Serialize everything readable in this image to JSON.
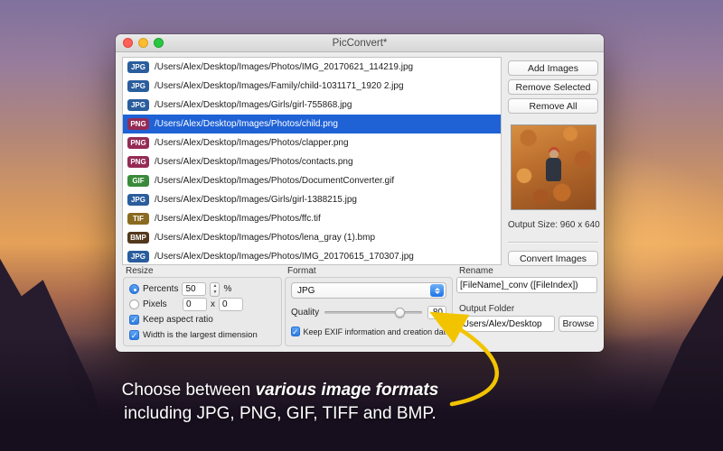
{
  "window": {
    "title": "PicConvert*",
    "buttons": {
      "add": "Add Images",
      "remove_selected": "Remove Selected",
      "remove_all": "Remove All",
      "convert": "Convert Images",
      "browse": "Browse"
    },
    "output_size": "Output Size: 960 x 640"
  },
  "file_list": {
    "items": [
      {
        "badge": "JPG",
        "path": "/Users/Alex/Desktop/Images/Photos/IMG_20170621_114219.jpg",
        "selected": false
      },
      {
        "badge": "JPG",
        "path": "/Users/Alex/Desktop/Images/Family/child-1031171_1920 2.jpg",
        "selected": false
      },
      {
        "badge": "JPG",
        "path": "/Users/Alex/Desktop/Images/Girls/girl-755868.jpg",
        "selected": false
      },
      {
        "badge": "PNG",
        "path": "/Users/Alex/Desktop/Images/Photos/child.png",
        "selected": true
      },
      {
        "badge": "PNG",
        "path": "/Users/Alex/Desktop/Images/Photos/clapper.png",
        "selected": false
      },
      {
        "badge": "PNG",
        "path": "/Users/Alex/Desktop/Images/Photos/contacts.png",
        "selected": false
      },
      {
        "badge": "GIF",
        "path": "/Users/Alex/Desktop/Images/Photos/DocumentConverter.gif",
        "selected": false
      },
      {
        "badge": "JPG",
        "path": "/Users/Alex/Desktop/Images/Girls/girl-1388215.jpg",
        "selected": false
      },
      {
        "badge": "TIF",
        "path": "/Users/Alex/Desktop/Images/Photos/ffc.tif",
        "selected": false
      },
      {
        "badge": "BMP",
        "path": "/Users/Alex/Desktop/Images/Photos/lena_gray (1).bmp",
        "selected": false
      },
      {
        "badge": "JPG",
        "path": "/Users/Alex/Desktop/Images/Photos/IMG_20170615_170307.jpg",
        "selected": false
      }
    ]
  },
  "resize": {
    "group_label": "Resize",
    "percents_label": "Percents",
    "percents_value": "50",
    "percent_sign": "%",
    "pixels_label": "Pixels",
    "pixels_width": "0",
    "pixels_separator": "x",
    "pixels_height": "0",
    "keep_aspect_label": "Keep aspect ratio",
    "width_largest_label": "Width is the largest dimension"
  },
  "format": {
    "group_label": "Format",
    "selected_format": "JPG",
    "quality_label": "Quality",
    "quality_value": "80",
    "keep_exif_label": "Keep EXIF information and creation date"
  },
  "rename": {
    "group_label": "Rename",
    "value": "[FileName]_conv ([FileIndex])"
  },
  "output_folder": {
    "group_label": "Output Folder",
    "value": "/Users/Alex/Desktop"
  },
  "caption": {
    "line1_normal": "Choose between ",
    "line1_emphasis": "various image formats",
    "line2": "including JPG, PNG, GIF, TIFF and BMP."
  },
  "badge_colors": {
    "JPG": "#2a5d9c",
    "PNG": "#952b55",
    "GIF": "#3a8a3a",
    "TIF": "#8a6a20",
    "BMP": "#53381c"
  },
  "accent_colors": {
    "selection_blue": "#1f62d6",
    "arrow_yellow": "#f2c400"
  }
}
